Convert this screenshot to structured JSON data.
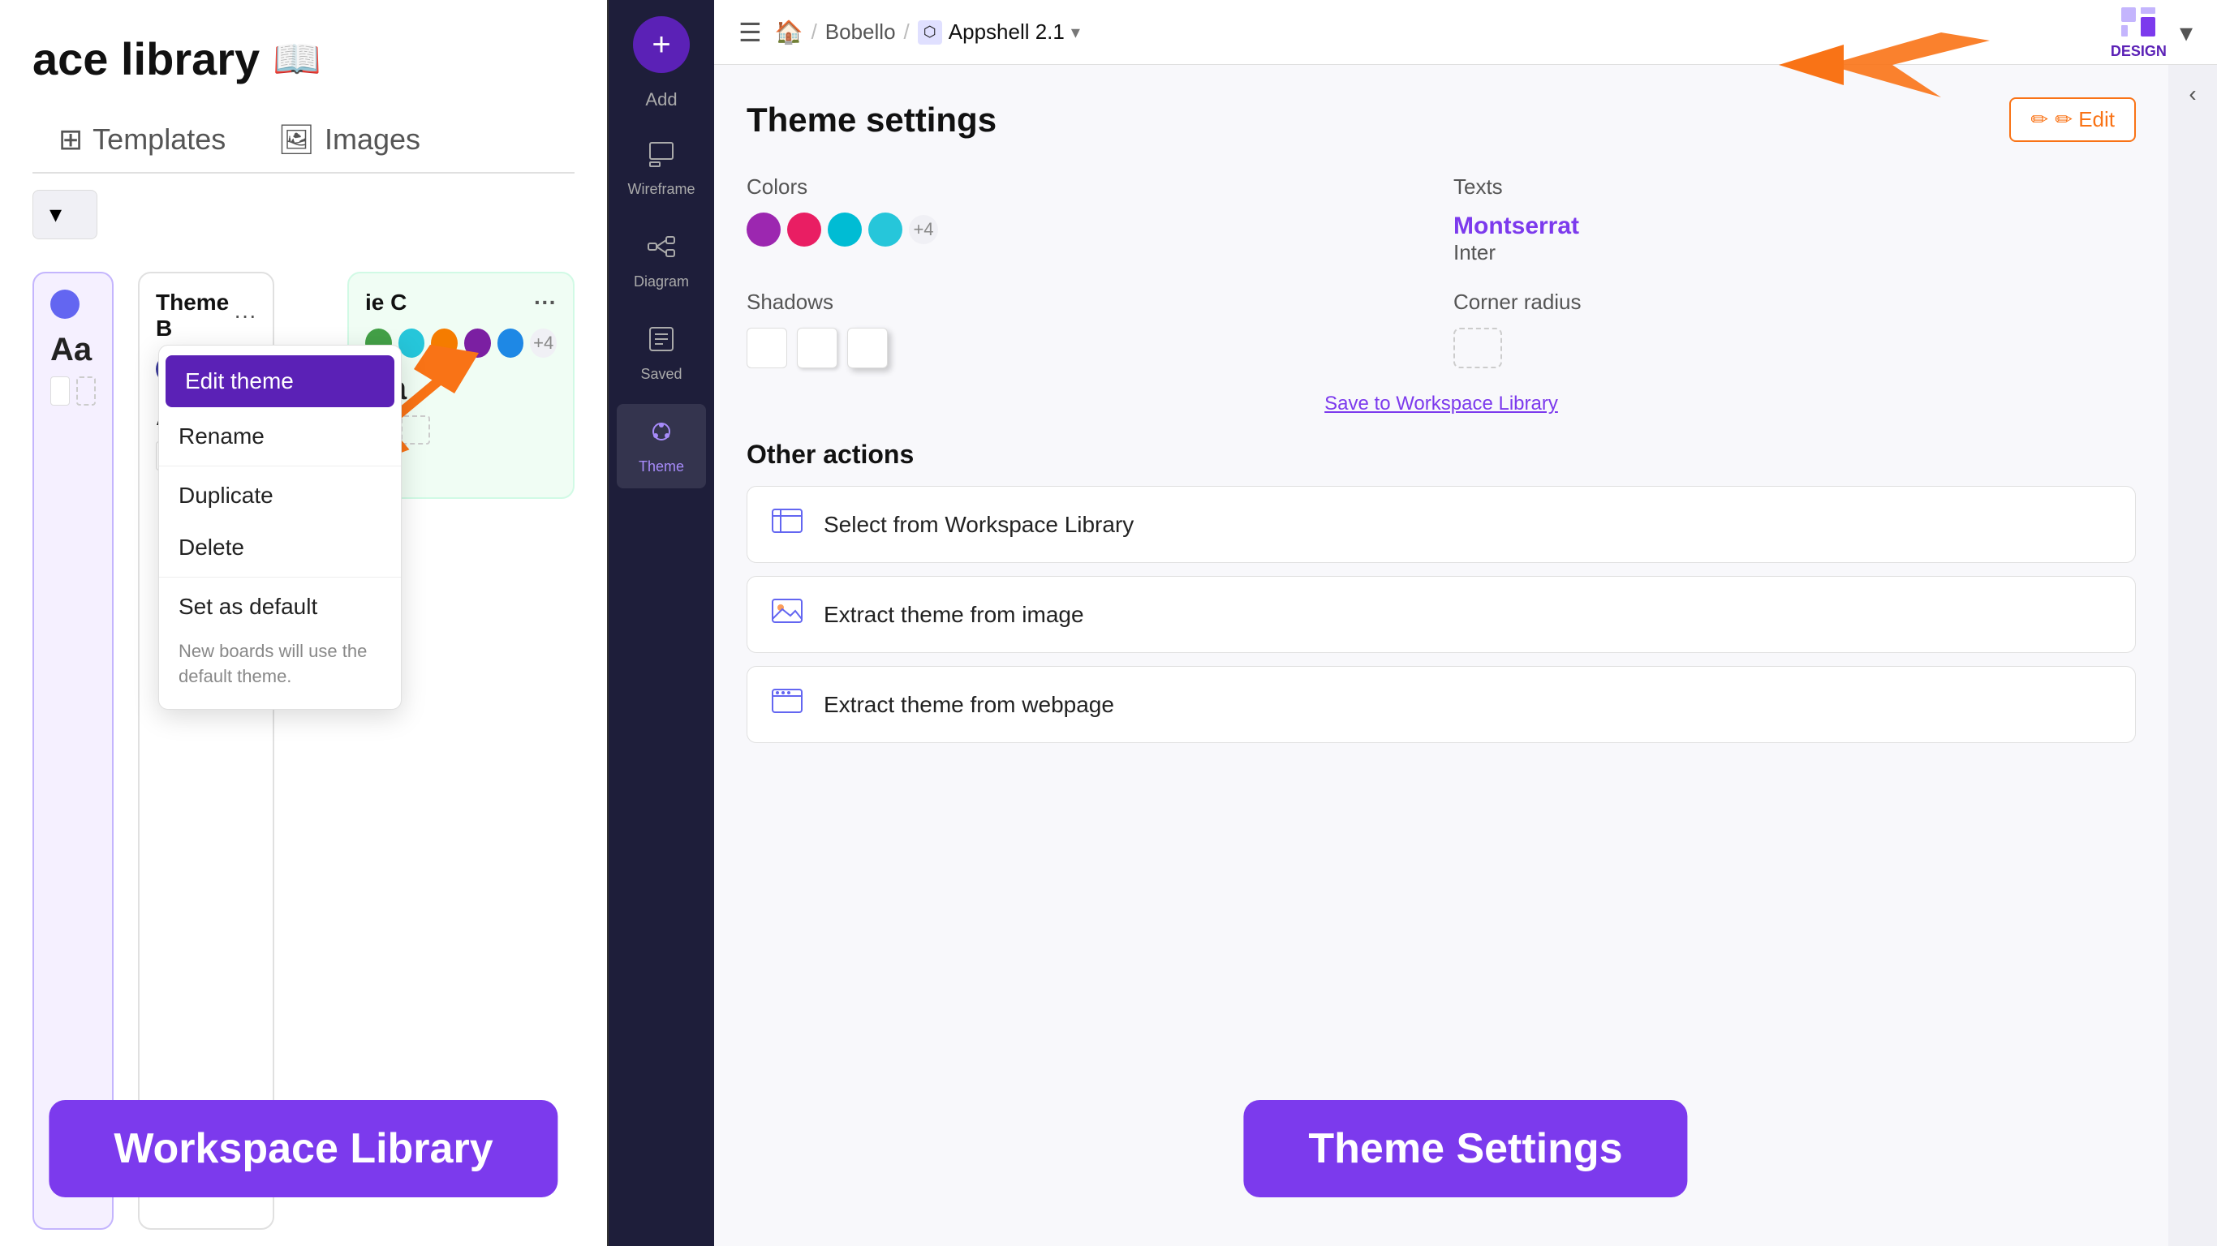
{
  "left_panel": {
    "title": "ace library",
    "tabs": [
      {
        "label": "Templates",
        "icon": "⊞",
        "active": false
      },
      {
        "label": "Images",
        "icon": "🖼",
        "active": false
      }
    ],
    "dropdown_label": "▾",
    "themes": [
      {
        "id": "theme-a",
        "colors": [
          "#3b3b9c",
          "#e040fb",
          "#f5a623"
        ],
        "font": "Aa",
        "selected": true,
        "dot_color": "#6366f1"
      },
      {
        "id": "theme-b",
        "title": "Theme B",
        "colors": [
          "#3b3b9c",
          "#e040fb",
          "#26c6da"
        ],
        "font": "Aa",
        "selected": false
      },
      {
        "id": "theme-c",
        "title": "ie C",
        "colors": [
          "#43a047",
          "#26c6da",
          "#f57c00",
          "#7b1fa2",
          "#1e88e5"
        ],
        "extra": "+4",
        "font": "Aa",
        "selected": false
      }
    ],
    "context_menu": {
      "items": [
        {
          "label": "Edit theme",
          "highlighted": true
        },
        {
          "label": "Rename"
        },
        {
          "label": "Duplicate"
        },
        {
          "label": "Delete"
        },
        {
          "label": "Set as default"
        }
      ],
      "note": "New boards will use the\ndefault theme."
    },
    "bottom_label": "Workspace Library"
  },
  "toolbar": {
    "add_label": "Add",
    "items": [
      {
        "label": "Wireframe",
        "icon": "wireframe"
      },
      {
        "label": "Diagram",
        "icon": "diagram"
      },
      {
        "label": "Saved",
        "icon": "saved"
      },
      {
        "label": "Theme",
        "icon": "theme",
        "active": true
      }
    ]
  },
  "top_bar": {
    "breadcrumb_home": "🏠",
    "breadcrumb_sep": "/",
    "workspace": "Bobello",
    "project_icon": "⬡",
    "project": "Appshell 2.1",
    "chevron": "▾",
    "design_label": "DESIGN",
    "expand": "▾"
  },
  "theme_settings": {
    "title": "Theme settings",
    "edit_label": "✏ Edit",
    "colors_label": "Colors",
    "color_dots": [
      "#9c27b0",
      "#e91e63",
      "#00bcd4",
      "#26c6da"
    ],
    "more_colors": "+4",
    "texts_label": "Texts",
    "font_primary": "Montserrat",
    "font_secondary": "Inter",
    "shadows_label": "Shadows",
    "corner_label": "Corner radius",
    "save_to_library": "Save to Workspace Library",
    "other_actions_title": "Other actions",
    "actions": [
      {
        "label": "Select from Workspace Library",
        "icon": "📚"
      },
      {
        "label": "Extract theme from image",
        "icon": "🖼"
      },
      {
        "label": "Extract theme from webpage",
        "icon": "🌐"
      }
    ],
    "bottom_label": "Theme Settings",
    "collapse_icon": "‹"
  }
}
